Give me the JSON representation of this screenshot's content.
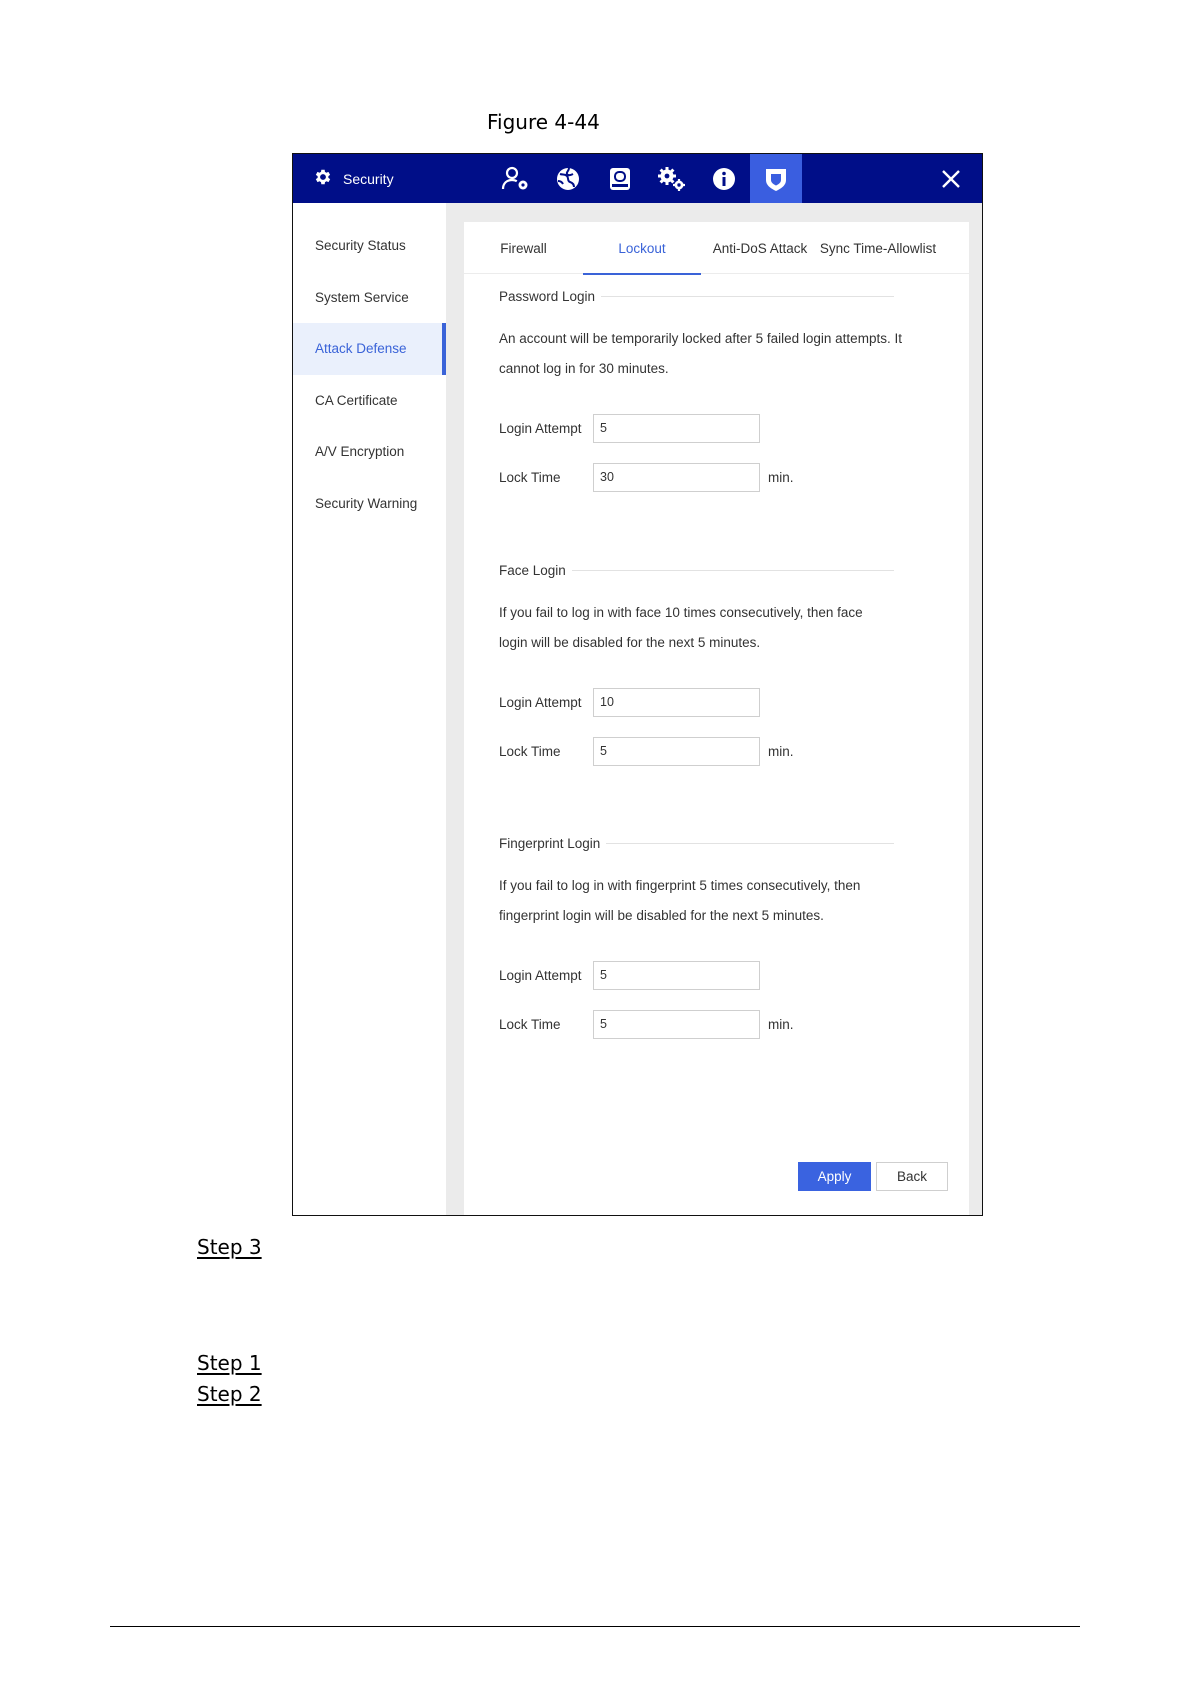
{
  "figure_caption": "Figure 4-44",
  "window": {
    "title": "Security",
    "topbar_icons": [
      {
        "name": "user-settings-icon"
      },
      {
        "name": "network-icon"
      },
      {
        "name": "storage-icon"
      },
      {
        "name": "system-settings-icon"
      },
      {
        "name": "info-icon"
      },
      {
        "name": "shield-icon"
      }
    ]
  },
  "sidebar": {
    "items": [
      {
        "label": "Security Status"
      },
      {
        "label": "System Service"
      },
      {
        "label": "Attack Defense"
      },
      {
        "label": "CA Certificate"
      },
      {
        "label": "A/V Encryption"
      },
      {
        "label": "Security Warning"
      }
    ],
    "active_label": "Attack Defense"
  },
  "tabs": [
    {
      "label": "Firewall"
    },
    {
      "label": "Lockout"
    },
    {
      "label": "Anti-DoS Attack"
    },
    {
      "label": "Sync Time-Allowlist"
    }
  ],
  "active_tab_label": "Lockout",
  "sections": {
    "password": {
      "title": "Password Login",
      "desc_line1": "An account will be temporarily locked after 5 failed login attempts. It",
      "desc_line2": "cannot log in for 30 minutes.",
      "login_attempt_label": "Login Attempt",
      "login_attempt_value": "5",
      "lock_time_label": "Lock Time",
      "lock_time_value": "30",
      "unit": "min."
    },
    "face": {
      "title": "Face Login",
      "desc_line1": "If you fail to log in with face 10 times consecutively, then face",
      "desc_line2": "login will be disabled for the next 5 minutes.",
      "login_attempt_label": "Login Attempt",
      "login_attempt_value": "10",
      "lock_time_label": "Lock Time",
      "lock_time_value": "5",
      "unit": "min."
    },
    "fingerprint": {
      "title": "Fingerprint Login",
      "desc_line1": "If you fail to log in with fingerprint 5 times consecutively, then",
      "desc_line2": "fingerprint login will be disabled for the next 5 minutes.",
      "login_attempt_label": "Login Attempt",
      "login_attempt_value": "5",
      "lock_time_label": "Lock Time",
      "lock_time_value": "5",
      "unit": "min."
    }
  },
  "buttons": {
    "apply": "Apply",
    "back": "Back"
  },
  "steps": [
    "Step 3",
    "Step 1",
    "Step 2"
  ]
}
